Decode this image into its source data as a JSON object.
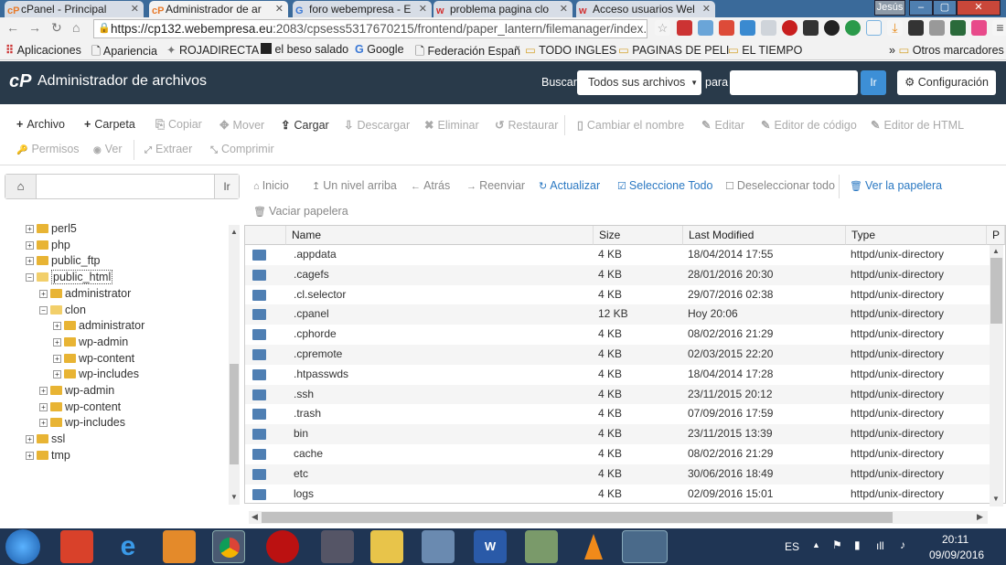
{
  "browser": {
    "tabs": [
      {
        "title": "cPanel - Principal",
        "icon": "cP",
        "color": "#e87a2a",
        "active": false
      },
      {
        "title": "Administrador de ar",
        "icon": "cP",
        "color": "#e87a2a",
        "active": true
      },
      {
        "title": "foro webempresa - E",
        "icon": "G",
        "color": "#3a78d6",
        "active": false
      },
      {
        "title": "problema pagina clo",
        "icon": "w",
        "color": "#d23030",
        "active": false
      },
      {
        "title": "Acceso usuarios Wel",
        "icon": "w",
        "color": "#d23030",
        "active": false
      }
    ],
    "user_badge": "Jesús",
    "url_host": "https://cp132.webempresa.eu",
    "url_path": ":2083/cpsess5317670215/frontend/paper_lantern/filemanager/index.htm",
    "bookmarks": [
      "Aplicaciones",
      "Apariencia",
      "ROJADIRECTA",
      "el beso salado",
      "Google",
      "Federación Españ",
      "TODO INGLES",
      "PAGINAS DE PELI",
      "EL TIEMPO"
    ],
    "other_bookmarks": "Otros marcadores"
  },
  "header": {
    "title": "Administrador de archivos",
    "search_label": "Buscar",
    "search_scope": "Todos sus archivos",
    "para_label": "para",
    "go_label": "Ir",
    "settings_label": "Configuración"
  },
  "toolbar": {
    "row1": [
      "Archivo",
      "Carpeta",
      "Copiar",
      "Mover",
      "Cargar",
      "Descargar",
      "Eliminar",
      "Restaurar",
      "Cambiar el nombre",
      "Editar",
      "Editor de código",
      "Editor de HTML"
    ],
    "row2": [
      "Permisos",
      "Ver",
      "Extraer",
      "Comprimir"
    ]
  },
  "pathbar": {
    "go_label": "Ir"
  },
  "navbar": {
    "home": "Inicio",
    "up": "Un nivel arriba",
    "back": "Atrás",
    "forward": "Reenviar",
    "reload": "Actualizar",
    "select_all": "Seleccione Todo",
    "deselect_all": "Deseleccionar todo",
    "trash": "Ver la papelera",
    "empty_trash": "Vaciar papelera"
  },
  "tree": [
    {
      "label": "perl5",
      "depth": 0,
      "open": false
    },
    {
      "label": "php",
      "depth": 0,
      "open": false
    },
    {
      "label": "public_ftp",
      "depth": 0,
      "open": false
    },
    {
      "label": "public_html",
      "depth": 0,
      "open": true,
      "selected": true
    },
    {
      "label": "administrator",
      "depth": 1,
      "open": false
    },
    {
      "label": "clon",
      "depth": 1,
      "open": true
    },
    {
      "label": "administrator",
      "depth": 2,
      "open": false
    },
    {
      "label": "wp-admin",
      "depth": 2,
      "open": false
    },
    {
      "label": "wp-content",
      "depth": 2,
      "open": false
    },
    {
      "label": "wp-includes",
      "depth": 2,
      "open": false
    },
    {
      "label": "wp-admin",
      "depth": 1,
      "open": false
    },
    {
      "label": "wp-content",
      "depth": 1,
      "open": false
    },
    {
      "label": "wp-includes",
      "depth": 1,
      "open": false
    },
    {
      "label": "ssl",
      "depth": 0,
      "open": false
    },
    {
      "label": "tmp",
      "depth": 0,
      "open": false
    }
  ],
  "table": {
    "columns": [
      "Name",
      "Size",
      "Last Modified",
      "Type",
      "P"
    ],
    "rows": [
      {
        "name": ".appdata",
        "size": "4 KB",
        "modified": "18/04/2014 17:55",
        "type": "httpd/unix-directory"
      },
      {
        "name": ".cagefs",
        "size": "4 KB",
        "modified": "28/01/2016 20:30",
        "type": "httpd/unix-directory"
      },
      {
        "name": ".cl.selector",
        "size": "4 KB",
        "modified": "29/07/2016 02:38",
        "type": "httpd/unix-directory"
      },
      {
        "name": ".cpanel",
        "size": "12 KB",
        "modified": "Hoy 20:06",
        "type": "httpd/unix-directory"
      },
      {
        "name": ".cphorde",
        "size": "4 KB",
        "modified": "08/02/2016 21:29",
        "type": "httpd/unix-directory"
      },
      {
        "name": ".cpremote",
        "size": "4 KB",
        "modified": "02/03/2015 22:20",
        "type": "httpd/unix-directory"
      },
      {
        "name": ".htpasswds",
        "size": "4 KB",
        "modified": "18/04/2014 17:28",
        "type": "httpd/unix-directory"
      },
      {
        "name": ".ssh",
        "size": "4 KB",
        "modified": "23/11/2015 20:12",
        "type": "httpd/unix-directory"
      },
      {
        "name": ".trash",
        "size": "4 KB",
        "modified": "07/09/2016 17:59",
        "type": "httpd/unix-directory"
      },
      {
        "name": "bin",
        "size": "4 KB",
        "modified": "23/11/2015 13:39",
        "type": "httpd/unix-directory"
      },
      {
        "name": "cache",
        "size": "4 KB",
        "modified": "08/02/2016 21:29",
        "type": "httpd/unix-directory"
      },
      {
        "name": "etc",
        "size": "4 KB",
        "modified": "30/06/2016 18:49",
        "type": "httpd/unix-directory"
      },
      {
        "name": "logs",
        "size": "4 KB",
        "modified": "02/09/2016 15:01",
        "type": "httpd/unix-directory"
      }
    ]
  },
  "taskbar": {
    "lang": "ES",
    "time": "20:11",
    "date": "09/09/2016"
  },
  "colors": {
    "header_bg": "#293a4a",
    "accent": "#3d8fd6",
    "folder_icon": "#4f7fb3",
    "tree_folder": "#e8b434",
    "taskbar": "#1f3554"
  }
}
